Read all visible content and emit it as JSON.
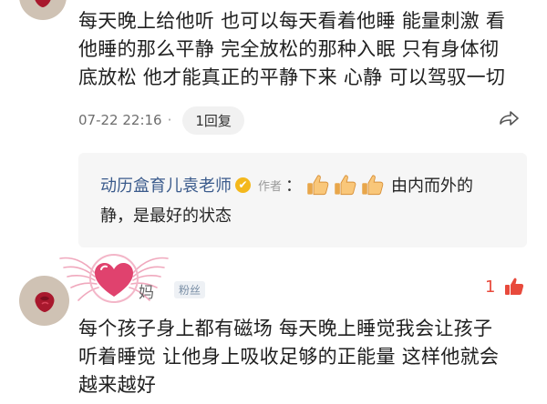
{
  "comment1": {
    "lines": [
      "每天晚上给他听 也可以每天看着他睡 能量刺激 看",
      "他睡的那么平静 完全放松的那种入眠 只有身体彻",
      "底放松 他才能真正的平静下来 心静 可以驾驭一切"
    ],
    "timestamp": "07-22 22:16",
    "separator": "·",
    "reply_count_label": "1回复"
  },
  "reply": {
    "author": "动历盒育儿袁老师",
    "verified_icon": "✔",
    "author_tag": "作者",
    "colon": "：",
    "text_line1": "由内而外的",
    "text_line2": "静，是最好的状态",
    "emojis": [
      "thumbs-up-icon",
      "thumbs-up-icon",
      "thumbs-up-icon"
    ]
  },
  "comment2": {
    "user_name": "妈",
    "badge": "粉丝",
    "like_count": "1",
    "lines": [
      "每个孩子身上都有磁场 每天晚上睡觉我会让孩子",
      "听着睡觉 让他身上吸收足够的正能量 这样他就会",
      "越来越好"
    ]
  },
  "colors": {
    "author_link": "#3b5b8c",
    "like_red": "#e84a3c",
    "verified_gold": "#f4b81c",
    "heart_pink": "#e0426e"
  }
}
